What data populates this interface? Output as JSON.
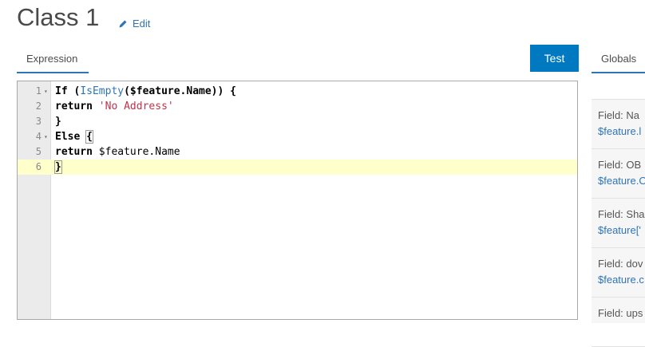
{
  "header": {
    "title": "Class 1",
    "edit_label": "Edit"
  },
  "tabs": {
    "expression": "Expression",
    "globals": "Globals"
  },
  "toolbar": {
    "test_label": "Test"
  },
  "editor": {
    "lines": [
      {
        "num": "1",
        "fold": true,
        "tokens": [
          [
            "kw",
            "If ("
          ],
          [
            "fn",
            "IsEmpty"
          ],
          [
            "kw",
            "($feature.Name)) {"
          ]
        ]
      },
      {
        "num": "2",
        "fold": false,
        "tokens": [
          [
            "kw",
            "return "
          ],
          [
            "str",
            "'No Address'"
          ]
        ]
      },
      {
        "num": "3",
        "fold": false,
        "tokens": [
          [
            "kw",
            "}"
          ]
        ]
      },
      {
        "num": "4",
        "fold": true,
        "tokens": [
          [
            "kw",
            "Else "
          ],
          [
            "kw hl",
            "{"
          ]
        ]
      },
      {
        "num": "5",
        "fold": false,
        "tokens": [
          [
            "kw",
            "return "
          ],
          [
            "plain",
            "$feature.Name"
          ]
        ]
      },
      {
        "num": "6",
        "fold": false,
        "tokens": [
          [
            "kw hl",
            "}"
          ]
        ]
      }
    ],
    "active_line": "6"
  },
  "globals_items": [
    {
      "label": "Field: Na",
      "value": "$feature.l"
    },
    {
      "label": "Field: OB",
      "value": "$feature.O"
    },
    {
      "label": "Field: Sha",
      "value": "$feature['"
    },
    {
      "label": "Field: dov",
      "value": "$feature.c"
    },
    {
      "label": "Field: ups",
      "value": ""
    }
  ]
}
